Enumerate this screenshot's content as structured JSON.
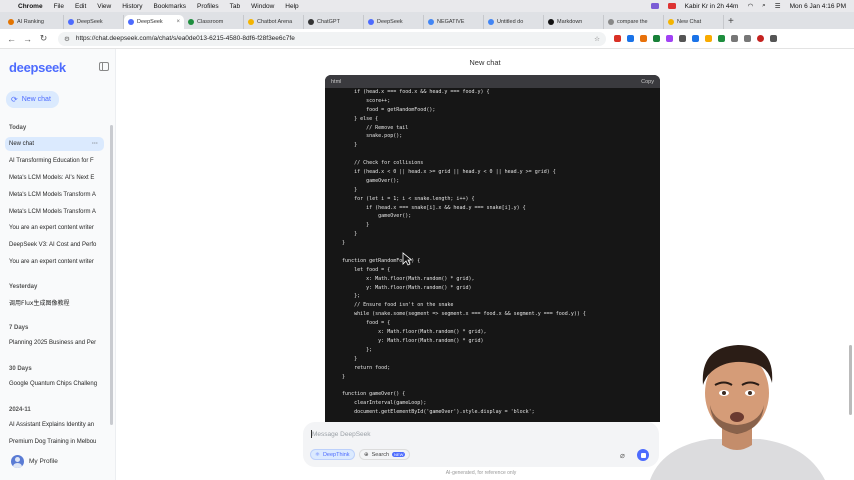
{
  "menubar": {
    "app": "Chrome",
    "items": [
      "File",
      "Edit",
      "View",
      "History",
      "Bookmarks",
      "Profiles",
      "Tab",
      "Window",
      "Help"
    ],
    "battery": "Kabir Kr in 2h 44m",
    "datetime": "Mon 6 Jan 4:16 PM"
  },
  "tabs": [
    {
      "title": "AI Ranking",
      "color": "#e37400"
    },
    {
      "title": "DeepSeek",
      "color": "#4d6bfe"
    },
    {
      "title": "DeepSeek",
      "color": "#4d6bfe",
      "active": true
    },
    {
      "title": "Classroom",
      "color": "#1e8e3e"
    },
    {
      "title": "Chatbot Arena",
      "color": "#f4b400"
    },
    {
      "title": "ChatGPT",
      "color": "#333333"
    },
    {
      "title": "DeepSeek",
      "color": "#4d6bfe"
    },
    {
      "title": "NEGATIVE",
      "color": "#4285f4"
    },
    {
      "title": "Untitled do",
      "color": "#4285f4"
    },
    {
      "title": "Markdown",
      "color": "#111111"
    },
    {
      "title": "compare the",
      "color": "#888888"
    },
    {
      "title": "New Chat",
      "color": "#f4b400"
    }
  ],
  "address": {
    "url": "https://chat.deepseek.com/a/chat/s/ea0de013-6215-4580-8df6-f28f3ee6c7fe"
  },
  "sidebar": {
    "logo": "deepseek",
    "new_chat": "New chat",
    "groups": [
      {
        "label": "Today",
        "items": [
          "New chat",
          "AI Transforming Education for F",
          "Meta's LCM Models: AI's Next E",
          "Meta's LCM Models Transform A",
          "Meta's LCM Models Transform A",
          "You are an expert content writer",
          "DeepSeek V3: AI Cost and Perfo",
          "You are an expert content writer"
        ]
      },
      {
        "label": "Yesterday",
        "items": [
          "调用Flux生成图像教程"
        ]
      },
      {
        "label": "7 Days",
        "items": [
          "Planning 2025 Business and Per"
        ]
      },
      {
        "label": "30 Days",
        "items": [
          "Google Quantum Chips Challeng"
        ]
      },
      {
        "label": "2024-11",
        "items": [
          "AI Assistant Explains Identity an",
          "Premium Dog Training in Melbou"
        ]
      }
    ],
    "profile": "My Profile"
  },
  "main": {
    "title": "New chat",
    "code_lang": "html",
    "copy_label": "Copy",
    "code_lines": [
      "    if (head.x === food.x && head.y === food.y) {",
      "        score++;",
      "        food = getRandomFood();",
      "    } else {",
      "        // Remove tail",
      "        snake.pop();",
      "    }",
      "",
      "    // Check for collisions",
      "    if (head.x < 0 || head.x >= grid || head.y < 0 || head.y >= grid) {",
      "        gameOver();",
      "    }",
      "    for (let i = 1; i < snake.length; i++) {",
      "        if (head.x === snake[i].x && head.y === snake[i].y) {",
      "            gameOver();",
      "        }",
      "    }",
      "}",
      "",
      "function getRandomFood() {",
      "    let food = {",
      "        x: Math.floor(Math.random() * grid),",
      "        y: Math.floor(Math.random() * grid)",
      "    };",
      "    // Ensure food isn't on the snake",
      "    while (snake.some(segment => segment.x === food.x && segment.y === food.y)) {",
      "        food = {",
      "            x: Math.floor(Math.random() * grid),",
      "            y: Math.floor(Math.random() * grid)",
      "        };",
      "    }",
      "    return food;",
      "}",
      "",
      "function gameOver() {",
      "    clearInterval(gameLoop);",
      "    document.getElementById('gameOver').style.display = 'block';"
    ],
    "input_placeholder": "Message DeepSeek",
    "deepthink": "DeepThink",
    "search": "Search",
    "search_badge": "NEW",
    "disclaimer": "AI-generated, for reference only"
  }
}
